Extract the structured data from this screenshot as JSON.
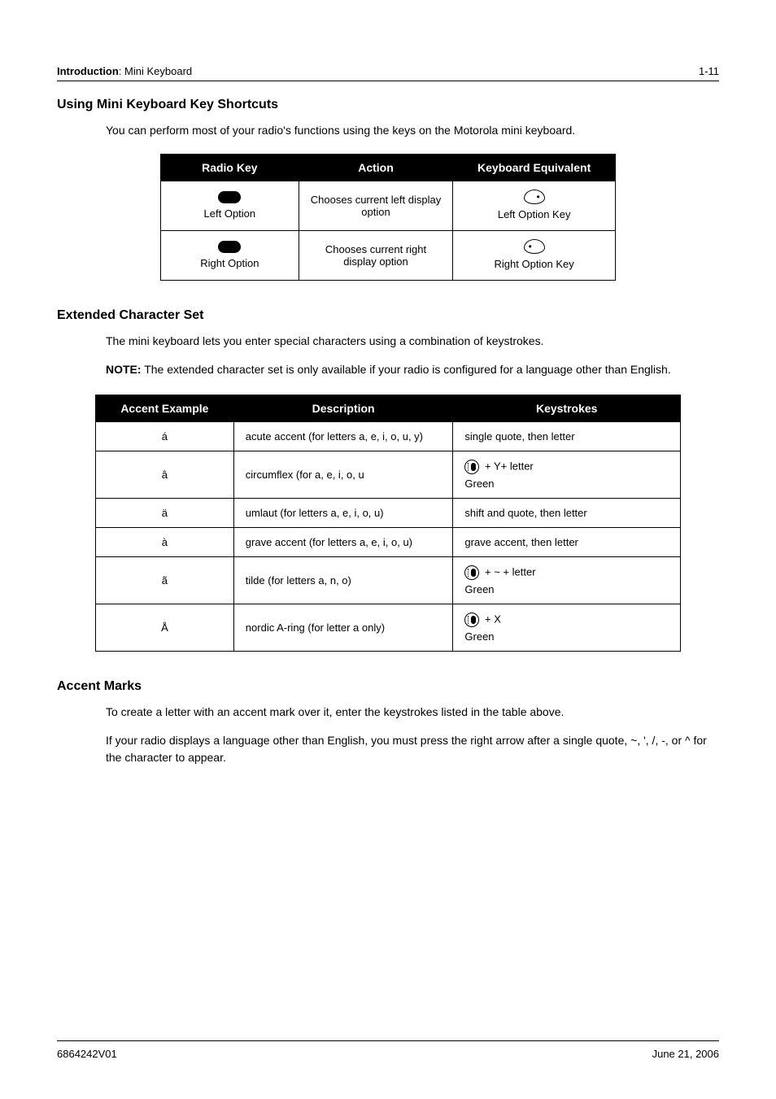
{
  "header": {
    "left": "Introduction: Mini Keyboard",
    "right": "1-11"
  },
  "section1": {
    "heading": "Using Mini Keyboard Key Shortcuts",
    "intro": "You can perform most of your radio's functions using the keys on the Motorola mini keyboard.",
    "table": {
      "headers": [
        "Radio Key",
        "Action",
        "Keyboard Equivalent"
      ],
      "rows": [
        {
          "radio_label": "Left Option",
          "action": "Chooses current left display option",
          "equiv_label": "Left Option Key"
        },
        {
          "radio_label": "Right Option",
          "action": "Chooses current right display option",
          "equiv_label": "Right Option Key"
        }
      ]
    }
  },
  "section2": {
    "heading": "Extended Character Set",
    "intro": "The mini keyboard lets you enter special characters using a combination of keystrokes.",
    "note_label": "NOTE:",
    "note_text": "The extended character set is only available if your radio is configured for a language other than English.",
    "table": {
      "headers": [
        "Accent Example",
        "Description",
        "Keystrokes"
      ],
      "rows": [
        {
          "ex": "á",
          "desc": "acute accent (for letters a, e, i, o, u, y)",
          "keys_type": "text",
          "keys_text": "single quote, then letter"
        },
        {
          "ex": "â",
          "desc": "circumflex (for a, e, i, o, u",
          "keys_type": "green",
          "keys_line1": " + Y+ letter",
          "keys_line2": "Green"
        },
        {
          "ex": "ä",
          "desc": "umlaut (for letters a, e, i, o, u)",
          "keys_type": "text",
          "keys_text": "shift and quote, then letter"
        },
        {
          "ex": "à",
          "desc": "grave accent (for letters a, e, i, o, u)",
          "keys_type": "text",
          "keys_text": "grave accent, then letter"
        },
        {
          "ex": "ã",
          "desc": "tilde (for letters a, n, o)",
          "keys_type": "green",
          "keys_line1": " + ~ + letter",
          "keys_line2": "Green"
        },
        {
          "ex": "Å",
          "desc": "nordic A-ring (for letter a only)",
          "keys_type": "green",
          "keys_line1": " + X",
          "keys_line2": "Green"
        }
      ]
    }
  },
  "section3": {
    "heading": "Accent Marks",
    "p1": "To create a letter with an accent mark over it, enter the keystrokes listed in the table above.",
    "p2": "If your radio displays a language other than English, you must press the right arrow after a single quote, ~, ', /, -, or ^ for the character to appear."
  },
  "footer": {
    "left": "6864242V01",
    "right": "June 21, 2006"
  }
}
